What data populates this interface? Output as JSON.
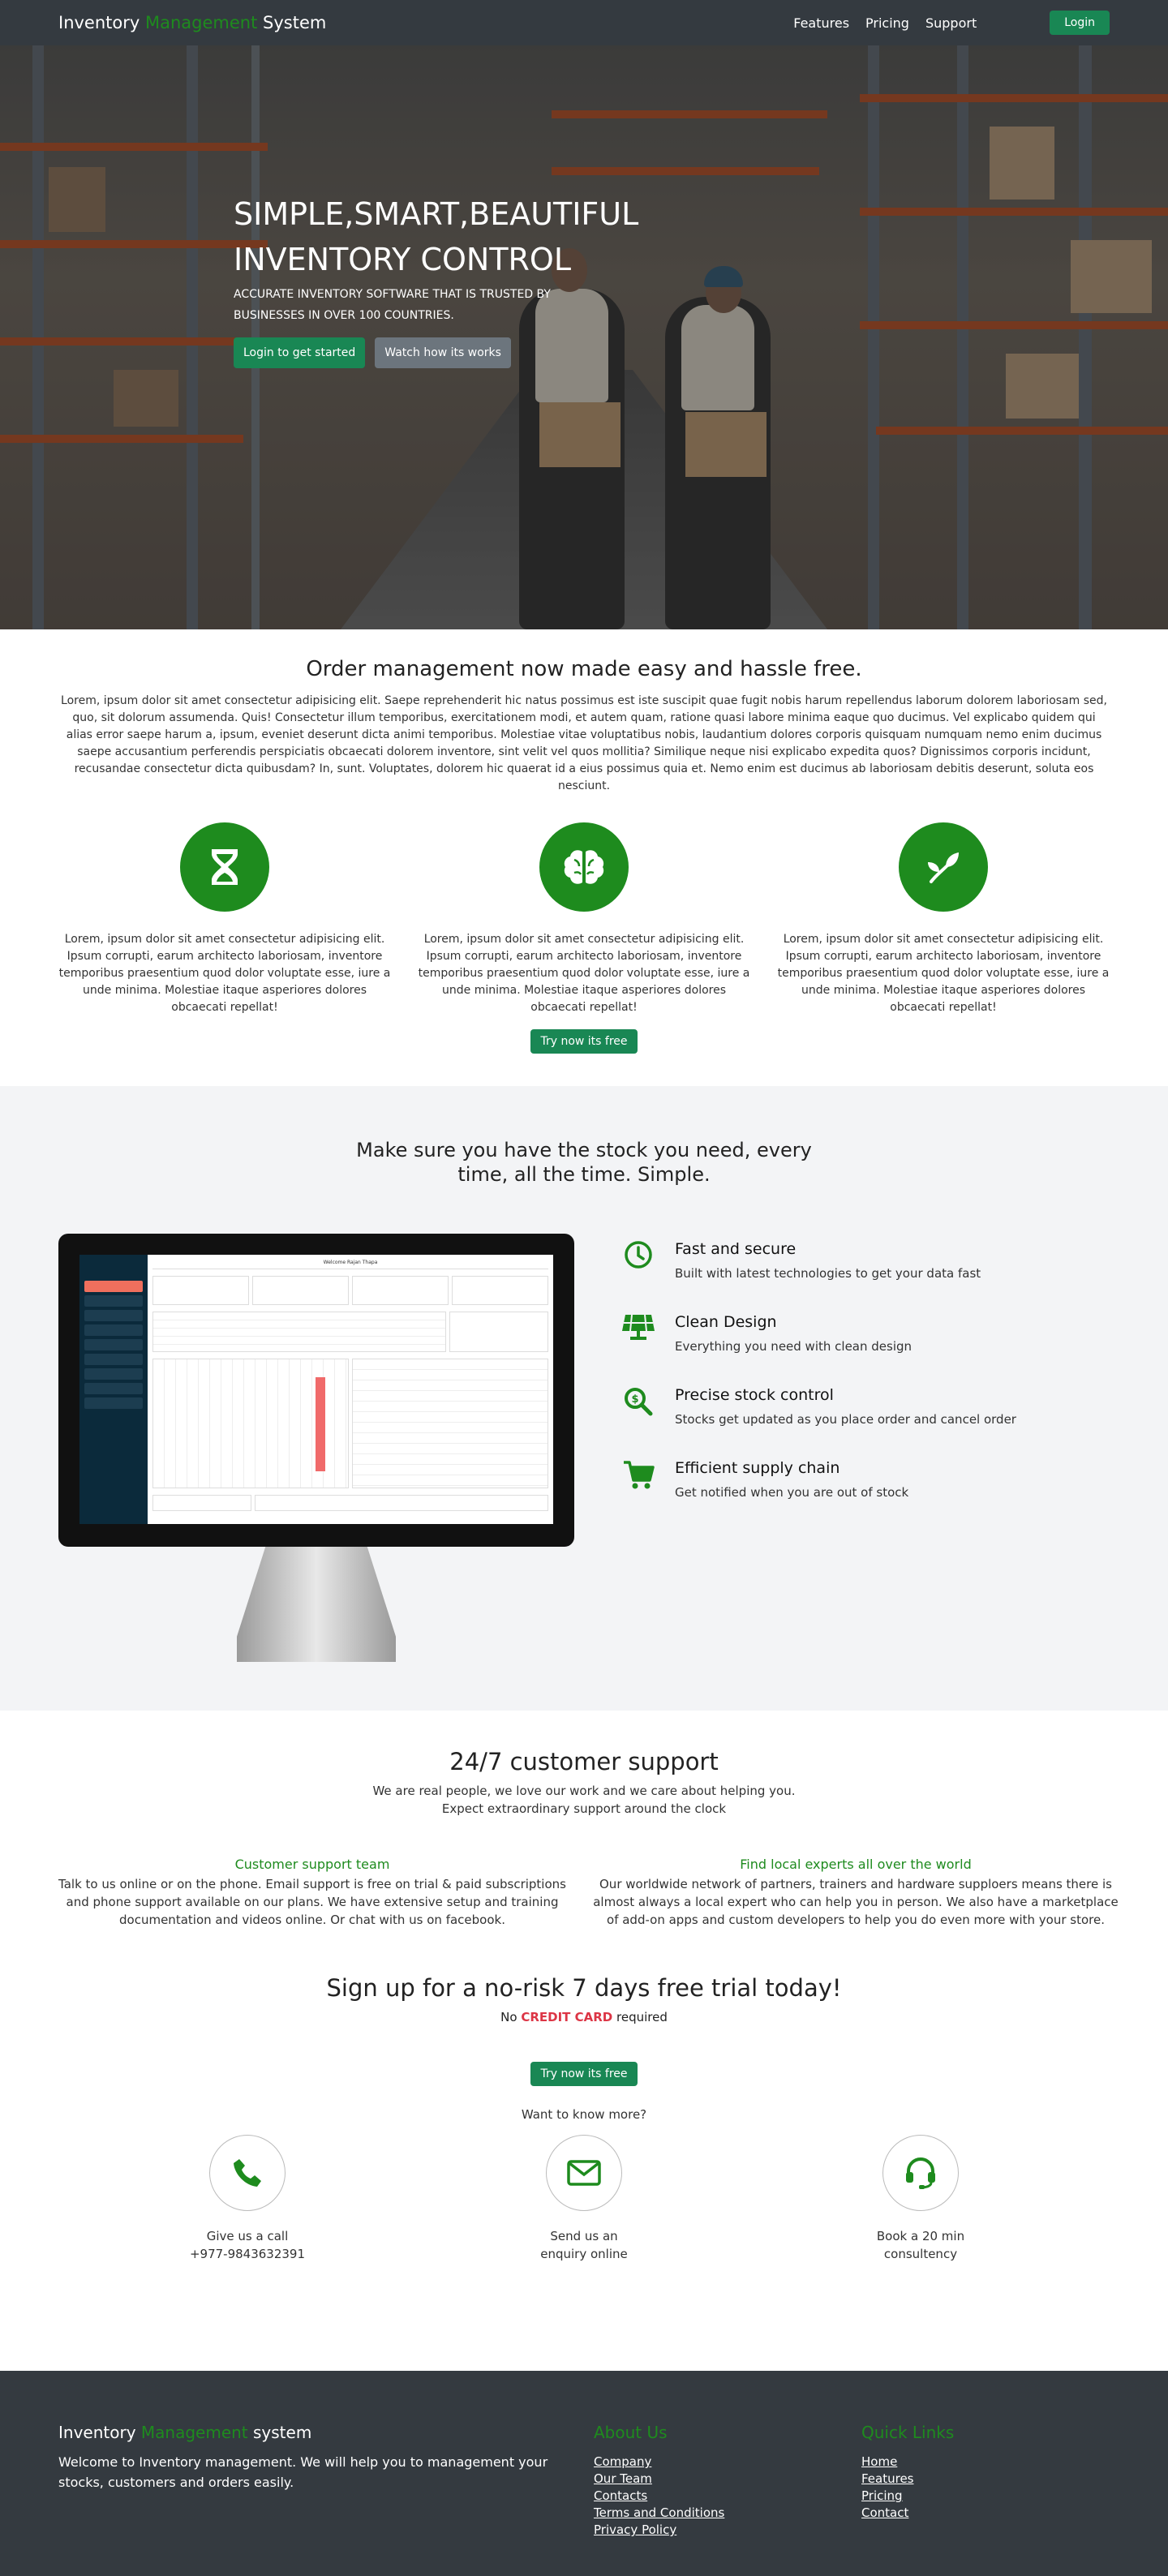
{
  "nav": {
    "brand_prefix": "Inventory",
    "brand_highlight": "Management",
    "brand_suffix": "System",
    "links": [
      "Features",
      "Pricing",
      "Support"
    ],
    "login_label": "Login"
  },
  "hero": {
    "title": "SIMPLE,SMART,BEAUTIFUL INVENTORY CONTROL",
    "subtitle": "ACCURATE INVENTORY SOFTWARE THAT IS TRUSTED BY BUSINESSES IN OVER 100 COUNTRIES.",
    "primary_btn": "Login to get started",
    "secondary_btn": "Watch how its works"
  },
  "order": {
    "title": "Order management now made easy and hassle free.",
    "paragraph": "Lorem, ipsum dolor sit amet consectetur adipisicing elit. Saepe reprehenderit hic natus possimus est iste suscipit quae fugit nobis harum repellendus laborum dolorem laboriosam sed, quo, sit dolorum assumenda. Quis! Consectetur illum temporibus, exercitationem modi, et autem quam, ratione quasi labore minima eaque quo ducimus. Vel explicabo quidem qui alias error saepe harum a, ipsum, eveniet deserunt dicta animi temporibus. Molestiae vitae voluptatibus nobis, laudantium dolores corporis quisquam numquam nemo enim ducimus saepe accusantium perferendis perspiciatis obcaecati dolorem inventore, sint velit vel quos mollitia? Similique neque nisi explicabo expedita quos? Dignissimos corporis incidunt, recusandae consectetur dicta quibusdam? In, sunt. Voluptates, dolorem hic quaerat id a eius possimus quia et. Nemo enim est ducimus ab laboriosam debitis deserunt, soluta eos nesciunt.",
    "features": [
      {
        "icon": "hourglass-icon",
        "text": "Lorem, ipsum dolor sit amet consectetur adipisicing elit. Ipsum corrupti, earum architecto laboriosam, inventore temporibus praesentium quod dolor voluptate esse, iure a unde minima. Molestiae itaque asperiores dolores obcaecati repellat!"
      },
      {
        "icon": "brain-icon",
        "text": "Lorem, ipsum dolor sit amet consectetur adipisicing elit. Ipsum corrupti, earum architecto laboriosam, inventore temporibus praesentium quod dolor voluptate esse, iure a unde minima. Molestiae itaque asperiores dolores obcaecati repellat!"
      },
      {
        "icon": "seedling-icon",
        "text": "Lorem, ipsum dolor sit amet consectetur adipisicing elit. Ipsum corrupti, earum architecto laboriosam, inventore temporibus praesentium quod dolor voluptate esse, iure a unde minima. Molestiae itaque asperiores dolores obcaecati repellat!"
      }
    ],
    "try_btn": "Try now its free"
  },
  "stock": {
    "title": "Make sure you have the stock you need, every time, all the time. Simple.",
    "dashboard_welcome": "Welcome Rajan Thapa",
    "features": [
      {
        "icon": "clock-icon",
        "title": "Fast and secure",
        "desc": "Built with latest technologies to get your data fast"
      },
      {
        "icon": "solar-panel-icon",
        "title": "Clean Design",
        "desc": "Everything you need with clean design"
      },
      {
        "icon": "search-dollar-icon",
        "title": "Precise stock control",
        "desc": "Stocks get updated as you place order and cancel order"
      },
      {
        "icon": "cart-icon",
        "title": "Efficient supply chain",
        "desc": "Get notified when you are out of stock"
      }
    ]
  },
  "support": {
    "title": "24/7 customer support",
    "subtitle_line1": "We are real people, we love our work and we care about helping you.",
    "subtitle_line2": "Expect extraordinary support around the clock",
    "cols": [
      {
        "title": "Customer support team",
        "text": "Talk to us online or on the phone. Email support is free on trial & paid subscriptions and phone support available on our plans. We have extensive setup and training documentation and videos online. Or chat with us on facebook."
      },
      {
        "title": "Find local experts all over the world",
        "text": "Our worldwide network of partners, trainers and hardware supploers means there is almost always a local expert who can help you in person. We also have a marketplace of add-on apps and custom developers to help you do even more with your store."
      }
    ],
    "signup_title": "Sign up for a no-risk 7 days free trial today!",
    "no_cc_prefix": "No",
    "no_cc_highlight": "CREDIT CARD",
    "no_cc_suffix": "required",
    "try_btn": "Try now its free",
    "want_more": "Want to know more?",
    "contacts": [
      {
        "icon": "phone-icon",
        "line1": "Give us a call",
        "line2": "+977-9843632391"
      },
      {
        "icon": "envelope-icon",
        "line1": "Send us an",
        "line2": "enquiry online"
      },
      {
        "icon": "headset-icon",
        "line1": "Book a 20 min",
        "line2": "consultency"
      }
    ]
  },
  "footer": {
    "brand_prefix": "Inventory",
    "brand_highlight": "Management",
    "brand_suffix": "system",
    "desc": "Welcome to Inventory management. We will help you to management your stocks, customers and orders easily.",
    "about_title": "About Us",
    "about_links": [
      "Company",
      "Our Team",
      "Contacts",
      "Terms and Conditions",
      "Privacy Policy"
    ],
    "quick_title": "Quick Links",
    "quick_links": [
      "Home",
      "Features",
      "Pricing",
      "Contact"
    ]
  },
  "colors": {
    "accent": "#1e8b1e",
    "button": "#198754",
    "dark": "#343a40",
    "danger": "#dc3545"
  }
}
